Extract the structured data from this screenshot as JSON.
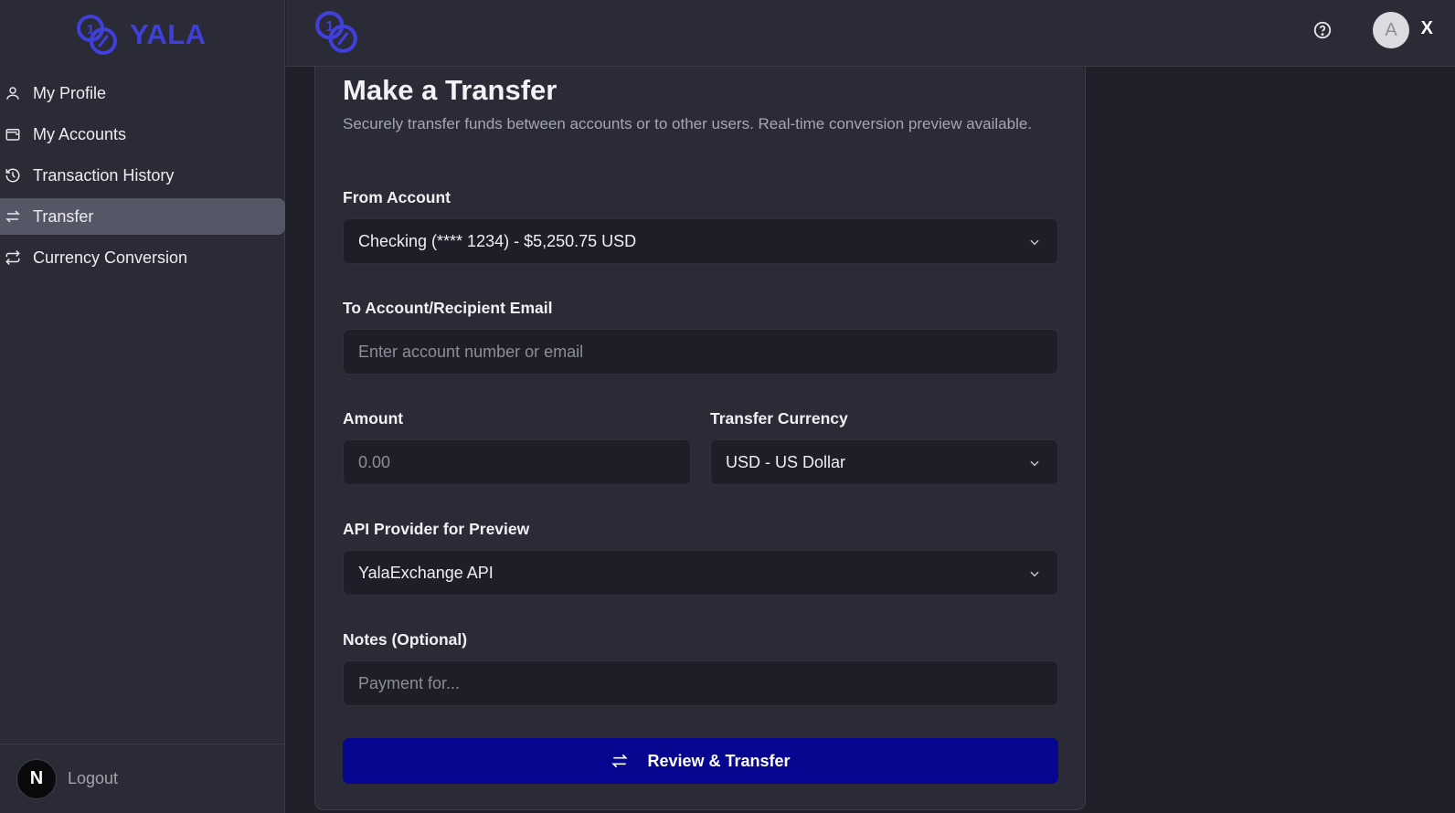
{
  "brand": {
    "name": "YALA",
    "accent": "#3f3fd9"
  },
  "sidebar": {
    "items": [
      {
        "label": "My Profile",
        "icon": "user-icon"
      },
      {
        "label": "My Accounts",
        "icon": "wallet-icon"
      },
      {
        "label": "Transaction History",
        "icon": "history-icon"
      },
      {
        "label": "Transfer",
        "icon": "transfer-icon",
        "active": true
      },
      {
        "label": "Currency Conversion",
        "icon": "repeat-icon"
      }
    ],
    "footer": {
      "badge": "N",
      "logout_label": "Logout"
    }
  },
  "topbar": {
    "avatar_initial": "A",
    "close_label": "X",
    "help_icon": "help-circle-icon"
  },
  "form": {
    "title": "Make a Transfer",
    "subtitle": "Securely transfer funds between accounts or to other users. Real-time conversion preview available.",
    "from_account": {
      "label": "From Account",
      "value": "Checking (**** 1234) - $5,250.75 USD"
    },
    "to_account": {
      "label": "To Account/Recipient Email",
      "placeholder": "Enter account number or email"
    },
    "amount": {
      "label": "Amount",
      "placeholder": "0.00"
    },
    "currency": {
      "label": "Transfer Currency",
      "value": "USD - US Dollar"
    },
    "api_provider": {
      "label": "API Provider for Preview",
      "value": "YalaExchange API"
    },
    "notes": {
      "label": "Notes (Optional)",
      "placeholder": "Payment for..."
    },
    "submit_label": "Review & Transfer",
    "submit_color": "#060691"
  }
}
